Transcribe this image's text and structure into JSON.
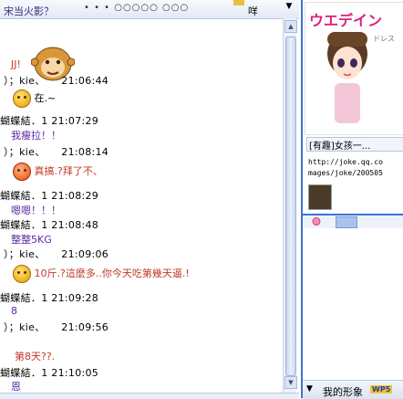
{
  "toolbar": {
    "title": "宋当火影？",
    "dots": "• • • ○○○○○ ○○○",
    "right_text": "咩",
    "menu_arrow": "▼"
  },
  "messages": [
    {
      "body": "JJ!",
      "style": "red"
    },
    {
      "sender": "）；kie、",
      "time": "21:06:44"
    },
    {
      "body": "在.~",
      "emoji": true
    },
    {
      "sender": "蝴蝶結．1",
      "time": "21:07:29"
    },
    {
      "body": "我瘦拉！！",
      "style": "purple"
    },
    {
      "sender": "）；kie、",
      "time": "21:08:14"
    },
    {
      "body": "真搞.?拜了不、",
      "emoji": true,
      "style": "red"
    },
    {
      "sender": "蝴蝶結．1",
      "time": "21:08:29"
    },
    {
      "body": "嗯嗯！！！",
      "style": "purple"
    },
    {
      "sender": "蝴蝶結．1",
      "time": "21:08:48"
    },
    {
      "body": "整整5KG",
      "style": "purple"
    },
    {
      "sender": "）；kie、",
      "time": "21:09:06"
    },
    {
      "body": "10斤.?這麼多..你今天吃第幾天逼.!",
      "emoji": true,
      "style": "red"
    },
    {
      "sender": "蝴蝶結．1",
      "time": "21:09:28"
    },
    {
      "body": "8",
      "style": "purple"
    },
    {
      "sender": "）；kie、",
      "time": "21:09:56"
    },
    {
      "body": "第8天??.",
      "style": "red"
    },
    {
      "sender": "蝴蝶結．1",
      "time": "21:10:05"
    },
    {
      "body": "恩",
      "style": "purple"
    }
  ],
  "side_panel": {
    "ad_logo": "ウエデイン",
    "ad_sub": "ドレス",
    "link_title": "[有趣]女孩一...",
    "url_line1": "http://joke.qq.co",
    "url_line2": "mages/joke/200505",
    "footer_label": "我的形象",
    "footer_badge": "WP5",
    "footer_arrow": "▼"
  },
  "scroll": {
    "up": "▲",
    "down": "▼"
  }
}
